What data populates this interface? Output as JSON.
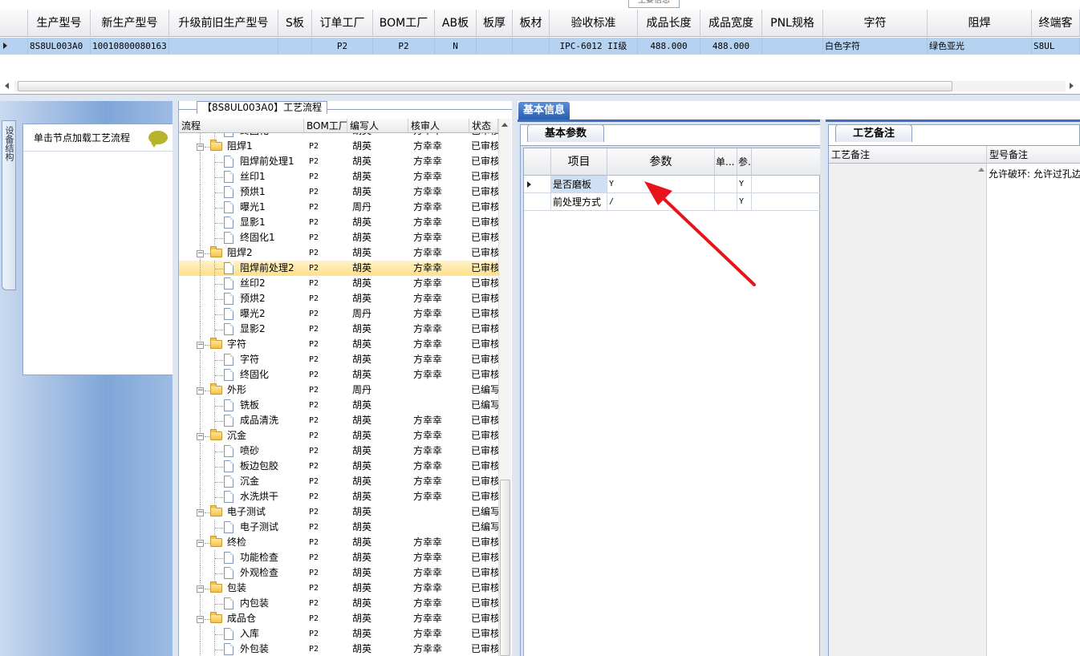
{
  "top_tab": "主要信息",
  "top_grid": {
    "columns": [
      "生产型号",
      "新生产型号",
      "升级前旧生产型号",
      "S板",
      "订单工厂",
      "BOM工厂",
      "AB板",
      "板厚",
      "板材",
      "验收标准",
      "成品长度",
      "成品宽度",
      "PNL规格",
      "字符",
      "阻焊",
      "终端客"
    ],
    "row": [
      "8S8UL003A0",
      "10010800080163",
      "",
      "",
      "P2",
      "P2",
      "N",
      "",
      "",
      "IPC-6012 II级",
      "488.000",
      "488.000",
      "",
      "白色字符",
      "绿色亚光",
      "S8UL"
    ]
  },
  "left_panel": {
    "vtab": "设备结构",
    "card_title": "单击节点加载工艺流程"
  },
  "tree": {
    "title": "【8S8UL003A0】工艺流程",
    "columns": [
      "流程",
      "BOM工厂",
      "编写人",
      "核审人",
      "状态"
    ],
    "rows": [
      {
        "name": "终固化",
        "level": 1,
        "bom": "P2",
        "writer": "胡英",
        "reviewer": "方幸幸",
        "status": "已审核"
      },
      {
        "name": "阻焊1",
        "level": 0,
        "bom": "P2",
        "writer": "胡英",
        "reviewer": "方幸幸",
        "status": "已审核"
      },
      {
        "name": "阻焊前处理1",
        "level": 1,
        "bom": "P2",
        "writer": "胡英",
        "reviewer": "方幸幸",
        "status": "已审核"
      },
      {
        "name": "丝印1",
        "level": 1,
        "bom": "P2",
        "writer": "胡英",
        "reviewer": "方幸幸",
        "status": "已审核"
      },
      {
        "name": "预烘1",
        "level": 1,
        "bom": "P2",
        "writer": "胡英",
        "reviewer": "方幸幸",
        "status": "已审核"
      },
      {
        "name": "曝光1",
        "level": 1,
        "bom": "P2",
        "writer": "周丹",
        "reviewer": "方幸幸",
        "status": "已审核"
      },
      {
        "name": "显影1",
        "level": 1,
        "bom": "P2",
        "writer": "胡英",
        "reviewer": "方幸幸",
        "status": "已审核"
      },
      {
        "name": "终固化1",
        "level": 1,
        "bom": "P2",
        "writer": "胡英",
        "reviewer": "方幸幸",
        "status": "已审核"
      },
      {
        "name": "阻焊2",
        "level": 0,
        "bom": "P2",
        "writer": "胡英",
        "reviewer": "方幸幸",
        "status": "已审核"
      },
      {
        "name": "阻焊前处理2",
        "level": 1,
        "bom": "P2",
        "writer": "胡英",
        "reviewer": "方幸幸",
        "status": "已审核",
        "selected": true
      },
      {
        "name": "丝印2",
        "level": 1,
        "bom": "P2",
        "writer": "胡英",
        "reviewer": "方幸幸",
        "status": "已审核"
      },
      {
        "name": "预烘2",
        "level": 1,
        "bom": "P2",
        "writer": "胡英",
        "reviewer": "方幸幸",
        "status": "已审核"
      },
      {
        "name": "曝光2",
        "level": 1,
        "bom": "P2",
        "writer": "周丹",
        "reviewer": "方幸幸",
        "status": "已审核"
      },
      {
        "name": "显影2",
        "level": 1,
        "bom": "P2",
        "writer": "胡英",
        "reviewer": "方幸幸",
        "status": "已审核"
      },
      {
        "name": "字符",
        "level": 0,
        "bom": "P2",
        "writer": "胡英",
        "reviewer": "方幸幸",
        "status": "已审核"
      },
      {
        "name": "字符",
        "level": 1,
        "bom": "P2",
        "writer": "胡英",
        "reviewer": "方幸幸",
        "status": "已审核"
      },
      {
        "name": "终固化",
        "level": 1,
        "bom": "P2",
        "writer": "胡英",
        "reviewer": "方幸幸",
        "status": "已审核"
      },
      {
        "name": "外形",
        "level": 0,
        "bom": "P2",
        "writer": "周丹",
        "reviewer": "",
        "status": "已编写"
      },
      {
        "name": "铣板",
        "level": 1,
        "bom": "P2",
        "writer": "胡英",
        "reviewer": "",
        "status": "已编写"
      },
      {
        "name": "成品清洗",
        "level": 1,
        "bom": "P2",
        "writer": "胡英",
        "reviewer": "方幸幸",
        "status": "已审核"
      },
      {
        "name": "沉金",
        "level": 0,
        "bom": "P2",
        "writer": "胡英",
        "reviewer": "方幸幸",
        "status": "已审核"
      },
      {
        "name": "喷砂",
        "level": 1,
        "bom": "P2",
        "writer": "胡英",
        "reviewer": "方幸幸",
        "status": "已审核"
      },
      {
        "name": "板边包胶",
        "level": 1,
        "bom": "P2",
        "writer": "胡英",
        "reviewer": "方幸幸",
        "status": "已审核"
      },
      {
        "name": "沉金",
        "level": 1,
        "bom": "P2",
        "writer": "胡英",
        "reviewer": "方幸幸",
        "status": "已审核"
      },
      {
        "name": "水洗烘干",
        "level": 1,
        "bom": "P2",
        "writer": "胡英",
        "reviewer": "方幸幸",
        "status": "已审核"
      },
      {
        "name": "电子测试",
        "level": 0,
        "bom": "P2",
        "writer": "胡英",
        "reviewer": "",
        "status": "已编写"
      },
      {
        "name": "电子测试",
        "level": 1,
        "bom": "P2",
        "writer": "胡英",
        "reviewer": "",
        "status": "已编写"
      },
      {
        "name": "终检",
        "level": 0,
        "bom": "P2",
        "writer": "胡英",
        "reviewer": "方幸幸",
        "status": "已审核"
      },
      {
        "name": "功能检查",
        "level": 1,
        "bom": "P2",
        "writer": "胡英",
        "reviewer": "方幸幸",
        "status": "已审核"
      },
      {
        "name": "外观检查",
        "level": 1,
        "bom": "P2",
        "writer": "胡英",
        "reviewer": "方幸幸",
        "status": "已审核"
      },
      {
        "name": "包装",
        "level": 0,
        "bom": "P2",
        "writer": "胡英",
        "reviewer": "方幸幸",
        "status": "已审核"
      },
      {
        "name": "内包装",
        "level": 1,
        "bom": "P2",
        "writer": "胡英",
        "reviewer": "方幸幸",
        "status": "已审核"
      },
      {
        "name": "成品仓",
        "level": 0,
        "bom": "P2",
        "writer": "胡英",
        "reviewer": "方幸幸",
        "status": "已审核"
      },
      {
        "name": "入库",
        "level": 1,
        "bom": "P2",
        "writer": "胡英",
        "reviewer": "方幸幸",
        "status": "已审核"
      },
      {
        "name": "外包装",
        "level": 1,
        "bom": "P2",
        "writer": "胡英",
        "reviewer": "方幸幸",
        "status": "已审核"
      }
    ]
  },
  "right": {
    "main_tab": "基本信息",
    "params_tab": "基本参数",
    "params_columns": [
      "项目",
      "参数",
      "单...",
      "参..."
    ],
    "params_rows": [
      {
        "item": "是否磨板",
        "value": "Y",
        "unit": "",
        "flag": "Y"
      },
      {
        "item": "前处理方式",
        "value": "/",
        "unit": "",
        "flag": "Y"
      }
    ],
    "notes_tab": "工艺备注",
    "notes_columns": [
      "工艺备注",
      "型号备注"
    ],
    "model_note": "允许破环: 允许过孔边"
  },
  "colors": {
    "header_tab": "#3d6fc0",
    "selected_row": "#b6d2f1",
    "tree_selected": "#ffe08a",
    "annotation_arrow": "#e8141c"
  }
}
